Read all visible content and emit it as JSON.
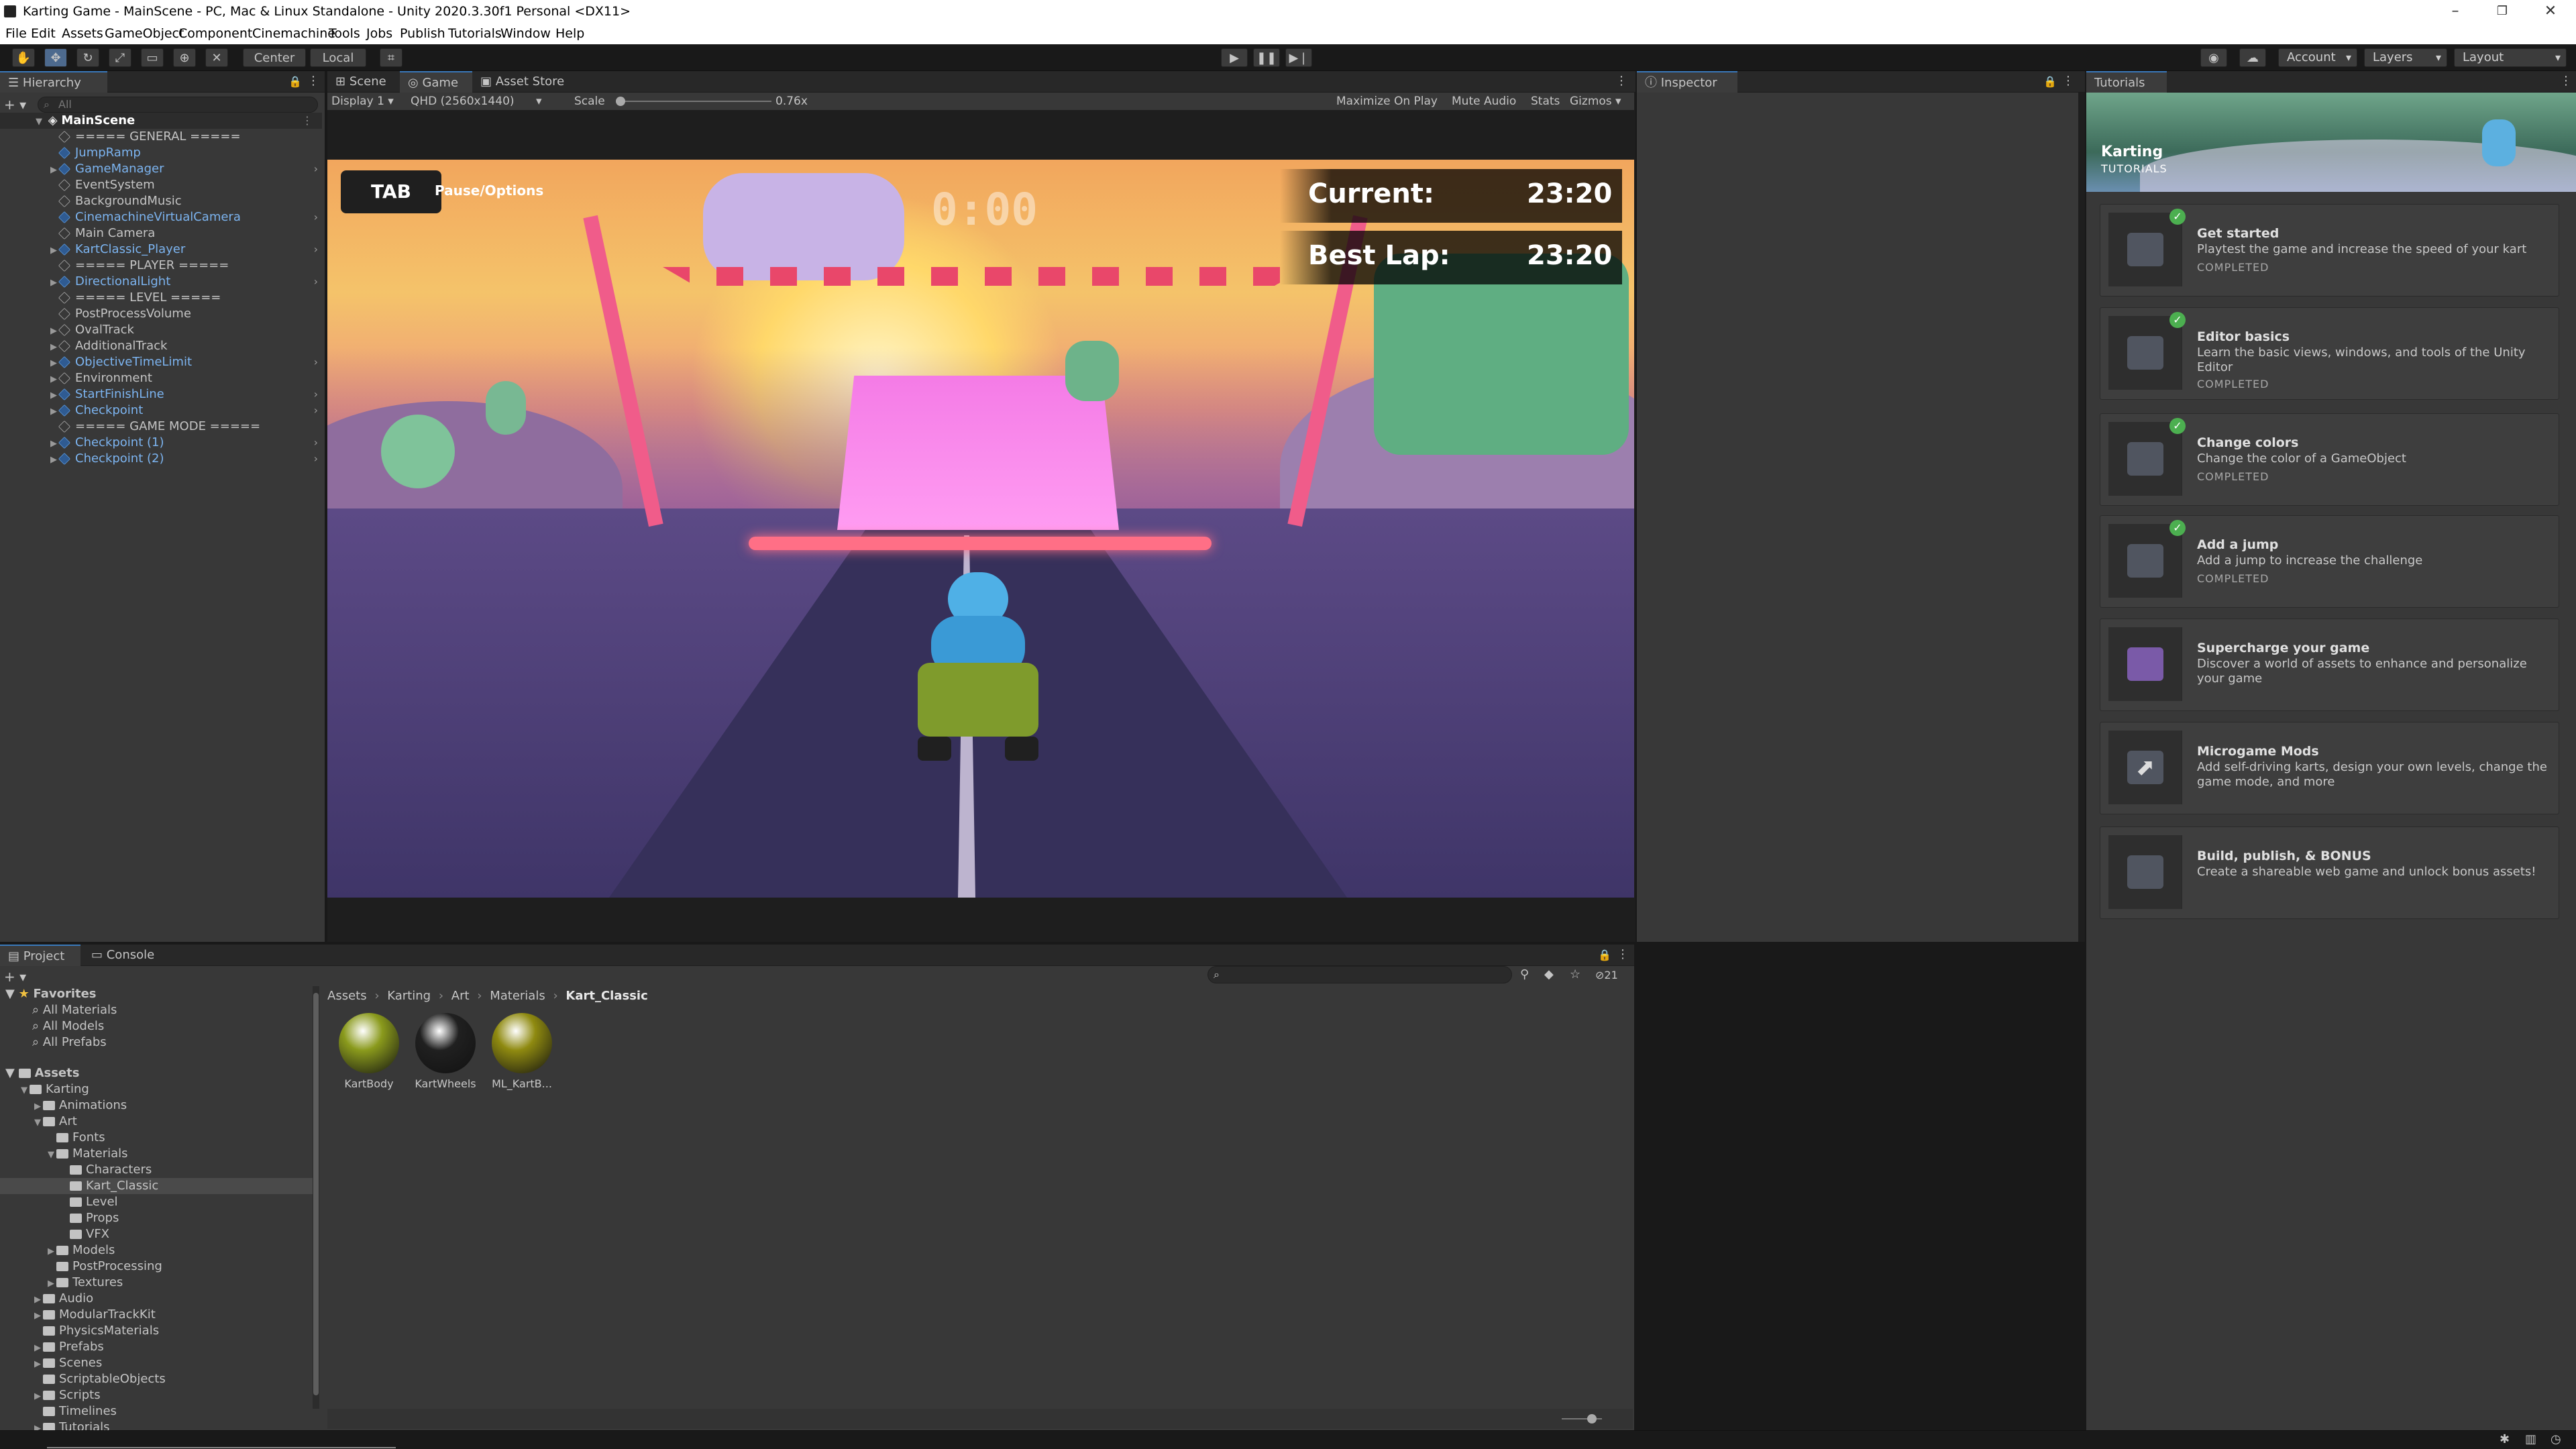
{
  "window": {
    "title": "Karting Game - MainScene - PC, Mac & Linux Standalone - Unity 2020.3.30f1 Personal <DX11>"
  },
  "menu": [
    "File",
    "Edit",
    "Assets",
    "GameObject",
    "Component",
    "Cinemachine",
    "Tools",
    "Jobs",
    "Publish",
    "Tutorials",
    "Window",
    "Help"
  ],
  "toolbar": {
    "center_label": "Center",
    "local_label": "Local",
    "account_label": "Account",
    "layers_label": "Layers",
    "layout_label": "Layout"
  },
  "hierarchy": {
    "tab": "Hierarchy",
    "search_placeholder": "All",
    "scene": "MainScene",
    "items": [
      {
        "label": "===== GENERAL =====",
        "prefab": false,
        "expander": false,
        "chevron": false
      },
      {
        "label": "JumpRamp",
        "prefab": true,
        "expander": false,
        "chevron": false
      },
      {
        "label": "GameManager",
        "prefab": true,
        "expander": true,
        "chevron": true
      },
      {
        "label": "EventSystem",
        "prefab": false,
        "expander": false,
        "chevron": false
      },
      {
        "label": "BackgroundMusic",
        "prefab": false,
        "expander": false,
        "chevron": false
      },
      {
        "label": "CinemachineVirtualCamera",
        "prefab": true,
        "expander": false,
        "chevron": true
      },
      {
        "label": "Main Camera",
        "prefab": false,
        "expander": false,
        "chevron": false
      },
      {
        "label": "KartClassic_Player",
        "prefab": true,
        "expander": true,
        "chevron": true
      },
      {
        "label": "===== PLAYER =====",
        "prefab": false,
        "expander": false,
        "chevron": false
      },
      {
        "label": "DirectionalLight",
        "prefab": true,
        "expander": true,
        "chevron": true
      },
      {
        "label": "===== LEVEL =====",
        "prefab": false,
        "expander": false,
        "chevron": false
      },
      {
        "label": "PostProcessVolume",
        "prefab": false,
        "expander": false,
        "chevron": false
      },
      {
        "label": "OvalTrack",
        "prefab": false,
        "expander": true,
        "chevron": false
      },
      {
        "label": "AdditionalTrack",
        "prefab": false,
        "expander": true,
        "chevron": false
      },
      {
        "label": "ObjectiveTimeLimit",
        "prefab": true,
        "expander": true,
        "chevron": true
      },
      {
        "label": "Environment",
        "prefab": false,
        "expander": true,
        "chevron": false
      },
      {
        "label": "StartFinishLine",
        "prefab": true,
        "expander": true,
        "chevron": true
      },
      {
        "label": "Checkpoint",
        "prefab": true,
        "expander": true,
        "chevron": true
      },
      {
        "label": "===== GAME MODE =====",
        "prefab": false,
        "expander": false,
        "chevron": false
      },
      {
        "label": "Checkpoint (1)",
        "prefab": true,
        "expander": true,
        "chevron": true
      },
      {
        "label": "Checkpoint (2)",
        "prefab": true,
        "expander": true,
        "chevron": true
      }
    ]
  },
  "center_tabs": [
    "Scene",
    "Game",
    "Asset Store"
  ],
  "game_toolbar": {
    "display": "Display 1",
    "resolution": "QHD (2560x1440)",
    "scale_label": "Scale",
    "scale_value": "0.76x",
    "maximize": "Maximize On Play",
    "mute": "Mute Audio",
    "stats": "Stats",
    "gizmos": "Gizmos"
  },
  "game_view": {
    "tab_key": "TAB",
    "pause_label": "Pause/Options",
    "timer": "0:00",
    "current_label": "Current:",
    "current_time": "23:20",
    "best_label": "Best Lap:",
    "best_time": "23:20"
  },
  "inspector": {
    "tab": "Inspector"
  },
  "tutorials": {
    "tab": "Tutorials",
    "banner_title": "Karting",
    "banner_sub": "TUTORIALS",
    "cards": [
      {
        "title": "Get started",
        "desc": "Playtest the game and increase the speed of your kart",
        "status": "COMPLETED"
      },
      {
        "title": "Editor basics",
        "desc": "Learn the basic views, windows, and tools of the Unity Editor",
        "status": "COMPLETED"
      },
      {
        "title": "Change colors",
        "desc": "Change the color of a GameObject",
        "status": "COMPLETED"
      },
      {
        "title": "Add a jump",
        "desc": "Add a jump to increase the challenge",
        "status": "COMPLETED"
      },
      {
        "title": "Supercharge your game",
        "desc": "Discover a world of assets to enhance and personalize your game",
        "status": ""
      },
      {
        "title": "Microgame Mods",
        "desc": "Add self-driving karts, design your own levels, change the game mode, and more",
        "status": ""
      },
      {
        "title": "Build, publish, & BONUS",
        "desc": "Create a shareable web game and unlock bonus assets!",
        "status": ""
      }
    ]
  },
  "project": {
    "tabs": [
      "Project",
      "Console"
    ],
    "favorites_label": "Favorites",
    "favorites": [
      "All Materials",
      "All Models",
      "All Prefabs"
    ],
    "assets_label": "Assets",
    "tree": [
      {
        "label": "Karting",
        "level": 1,
        "exp": "open"
      },
      {
        "label": "Animations",
        "level": 2,
        "exp": "closed"
      },
      {
        "label": "Art",
        "level": 2,
        "exp": "open"
      },
      {
        "label": "Fonts",
        "level": 3,
        "exp": "none"
      },
      {
        "label": "Materials",
        "level": 3,
        "exp": "open"
      },
      {
        "label": "Characters",
        "level": 4,
        "exp": "none"
      },
      {
        "label": "Kart_Classic",
        "level": 4,
        "exp": "none",
        "selected": true
      },
      {
        "label": "Level",
        "level": 4,
        "exp": "none"
      },
      {
        "label": "Props",
        "level": 4,
        "exp": "none"
      },
      {
        "label": "VFX",
        "level": 4,
        "exp": "none"
      },
      {
        "label": "Models",
        "level": 3,
        "exp": "closed"
      },
      {
        "label": "PostProcessing",
        "level": 3,
        "exp": "none"
      },
      {
        "label": "Textures",
        "level": 3,
        "exp": "closed"
      },
      {
        "label": "Audio",
        "level": 2,
        "exp": "closed"
      },
      {
        "label": "ModularTrackKit",
        "level": 2,
        "exp": "closed"
      },
      {
        "label": "PhysicsMaterials",
        "level": 2,
        "exp": "none"
      },
      {
        "label": "Prefabs",
        "level": 2,
        "exp": "closed"
      },
      {
        "label": "Scenes",
        "level": 2,
        "exp": "closed"
      },
      {
        "label": "ScriptableObjects",
        "level": 2,
        "exp": "none"
      },
      {
        "label": "Scripts",
        "level": 2,
        "exp": "closed"
      },
      {
        "label": "Timelines",
        "level": 2,
        "exp": "none"
      },
      {
        "label": "Tutorials",
        "level": 2,
        "exp": "closed"
      }
    ],
    "breadcrumb": [
      "Assets",
      "Karting",
      "Art",
      "Materials",
      "Kart_Classic"
    ],
    "count_badge": "21",
    "materials": [
      {
        "name": "KartBody",
        "color": "#8a9a1c"
      },
      {
        "name": "KartWheels",
        "color": "#202020"
      },
      {
        "name": "ML_KartB...",
        "color": "#8f8a10"
      }
    ]
  }
}
